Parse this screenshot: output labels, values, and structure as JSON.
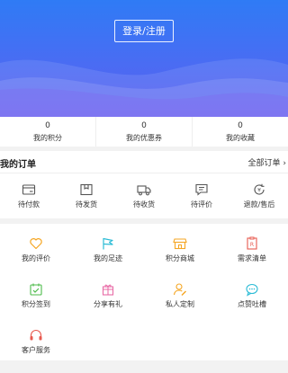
{
  "header": {
    "login_label": "登录/注册"
  },
  "stats": [
    {
      "value": "0",
      "label": "我的积分"
    },
    {
      "value": "0",
      "label": "我的优惠券"
    },
    {
      "value": "0",
      "label": "我的收藏"
    }
  ],
  "orders": {
    "title": "我的订单",
    "all_label": "全部订单",
    "items": [
      {
        "label": "待付款",
        "icon": "wallet-icon"
      },
      {
        "label": "待发货",
        "icon": "box-icon"
      },
      {
        "label": "待收货",
        "icon": "truck-icon"
      },
      {
        "label": "待评价",
        "icon": "comment-icon"
      },
      {
        "label": "退款/售后",
        "icon": "refund-icon"
      }
    ]
  },
  "services": [
    {
      "label": "我的评价",
      "icon": "heart-icon",
      "color": "#f5a623"
    },
    {
      "label": "我的足迹",
      "icon": "flag-icon",
      "color": "#2dbcd6"
    },
    {
      "label": "积分商城",
      "icon": "shop-icon",
      "color": "#f5a623"
    },
    {
      "label": "需求清单",
      "icon": "list-icon",
      "color": "#e85a4f"
    },
    {
      "label": "积分签到",
      "icon": "calendar-check-icon",
      "color": "#4cbb4a"
    },
    {
      "label": "分享有礼",
      "icon": "gift-icon",
      "color": "#e86aa6"
    },
    {
      "label": "私人定制",
      "icon": "user-edit-icon",
      "color": "#f5a623"
    },
    {
      "label": "点赞吐槽",
      "icon": "chat-bubble-icon",
      "color": "#2dbcd6"
    },
    {
      "label": "客户服务",
      "icon": "headset-icon",
      "color": "#e85a4f"
    }
  ]
}
